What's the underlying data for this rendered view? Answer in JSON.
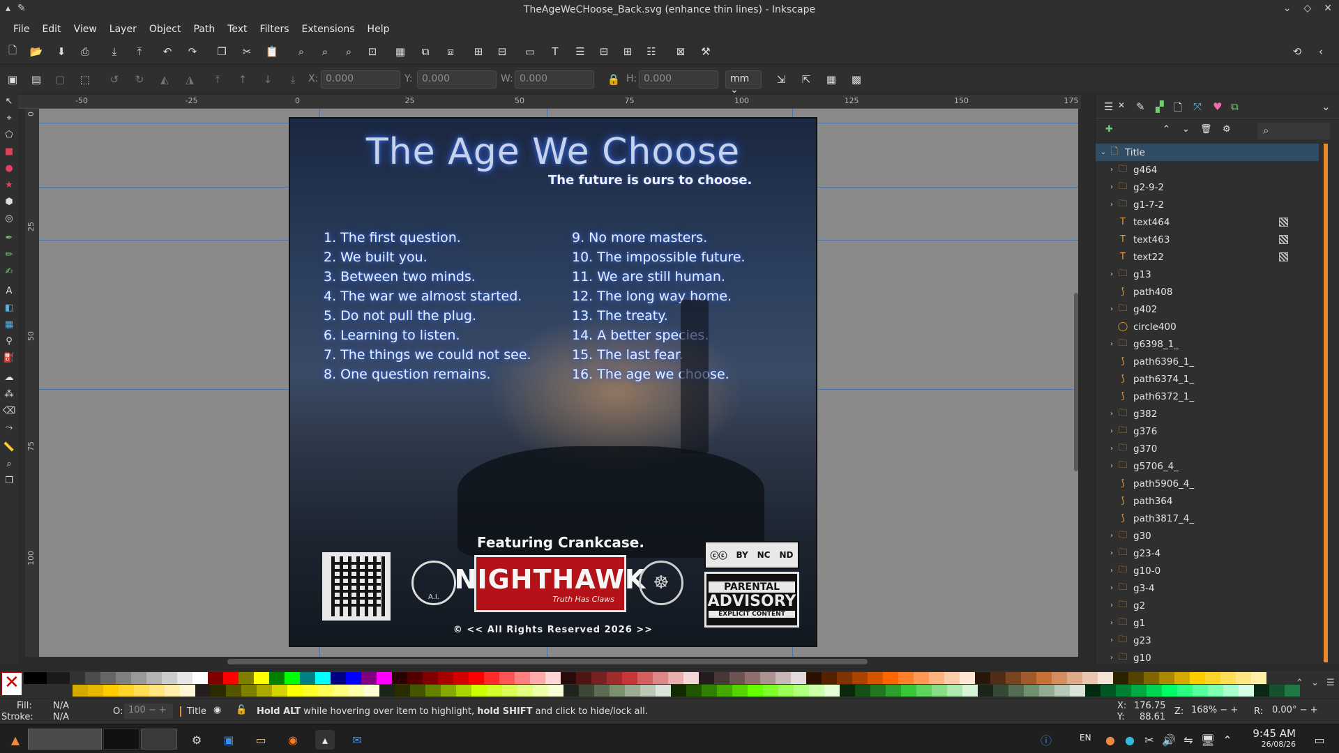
{
  "window": {
    "title": "TheAgeWeCHoose_Back.svg (enhance thin lines) - Inkscape"
  },
  "menu": [
    "File",
    "Edit",
    "View",
    "Layer",
    "Object",
    "Path",
    "Text",
    "Filters",
    "Extensions",
    "Help"
  ],
  "toolbar_icons": [
    "new-doc-icon",
    "open-icon",
    "save-icon",
    "print-icon",
    "import-icon",
    "export-icon",
    "undo-icon",
    "redo-icon",
    "copy-icon",
    "cut-icon",
    "paste-icon",
    "zoom-selection-icon",
    "zoom-drawing-icon",
    "zoom-page-icon",
    "zoom-width-icon",
    "duplicate-icon",
    "clone-icon",
    "unlink-clone-icon",
    "group-icon",
    "ungroup-icon",
    "xml-editor-icon",
    "text-icon",
    "layers-icon",
    "document-properties-icon",
    "align-icon",
    "preferences-icon",
    "fill-stroke-icon",
    "transform-icon"
  ],
  "transform": {
    "x_label": "X:",
    "x_value": "0.000",
    "y_label": "Y:",
    "y_value": "0.000",
    "w_label": "W:",
    "w_value": "0.000",
    "h_label": "H:",
    "h_value": "0.000",
    "unit": "mm"
  },
  "ruler": {
    "h_ticks": [
      "-50",
      "-25",
      "0",
      "25",
      "50",
      "75",
      "100",
      "125",
      "150",
      "175"
    ],
    "v_ticks": [
      "0",
      "25",
      "50",
      "75",
      "100"
    ]
  },
  "poster": {
    "title": "The Age We Choose",
    "subtitle": "The future is ours to choose.",
    "tracks_left": [
      "1. The first question.",
      "2. We built you.",
      "3. Between two minds.",
      "4. The war we almost started.",
      "5. Do not pull the plug.",
      "6.  Learning to listen.",
      "7. The things we could not see.",
      "8. One question remains."
    ],
    "tracks_right": [
      "9. No more masters.",
      "10. The impossible future.",
      "11. We are still human.",
      "12. The long way home.",
      "13. The treaty.",
      "14.  A better species.",
      "15. The last fear.",
      "16. The age we choose."
    ],
    "featuring": "Featuring Crankcase.",
    "ai_label": "A.I.",
    "label_name": "NIGHTHAWK",
    "label_tag": "Truth Has Claws",
    "cc_labels": [
      "BY",
      "NC",
      "ND"
    ],
    "advisory_top": "PARENTAL",
    "advisory_mid": "ADVISORY",
    "advisory_bottom": "EXPLICIT CONTENT",
    "rights": "© << All Rights Reserved 2026 >>"
  },
  "layers": [
    {
      "name": "Title",
      "type": "layer",
      "expand": "down",
      "selected": true
    },
    {
      "name": "g464",
      "type": "group",
      "expand": "right"
    },
    {
      "name": "g2-9-2",
      "type": "group",
      "expand": "right"
    },
    {
      "name": "g1-7-2",
      "type": "group",
      "expand": "right"
    },
    {
      "name": "text464",
      "type": "text",
      "expand": "",
      "mask": true
    },
    {
      "name": "text463",
      "type": "text",
      "expand": "",
      "mask": true
    },
    {
      "name": "text22",
      "type": "text",
      "expand": "",
      "mask": true
    },
    {
      "name": "g13",
      "type": "group",
      "expand": "right"
    },
    {
      "name": "path408",
      "type": "path",
      "expand": ""
    },
    {
      "name": "g402",
      "type": "group",
      "expand": "right"
    },
    {
      "name": "circle400",
      "type": "circle",
      "expand": ""
    },
    {
      "name": "g6398_1_",
      "type": "group",
      "expand": "right"
    },
    {
      "name": "path6396_1_",
      "type": "path",
      "expand": ""
    },
    {
      "name": "path6374_1_",
      "type": "path",
      "expand": ""
    },
    {
      "name": "path6372_1_",
      "type": "path",
      "expand": ""
    },
    {
      "name": "g382",
      "type": "group",
      "expand": "right"
    },
    {
      "name": "g376",
      "type": "group",
      "expand": "right"
    },
    {
      "name": "g370",
      "type": "group",
      "expand": "right"
    },
    {
      "name": "g5706_4_",
      "type": "group",
      "expand": "right"
    },
    {
      "name": "path5906_4_",
      "type": "path",
      "expand": ""
    },
    {
      "name": "path364",
      "type": "path",
      "expand": ""
    },
    {
      "name": "path3817_4_",
      "type": "path",
      "expand": ""
    },
    {
      "name": "g30",
      "type": "group",
      "expand": "right"
    },
    {
      "name": "g23-4",
      "type": "group",
      "expand": "right"
    },
    {
      "name": "g10-0",
      "type": "group",
      "expand": "right"
    },
    {
      "name": "g3-4",
      "type": "group",
      "expand": "right"
    },
    {
      "name": "g2",
      "type": "group",
      "expand": "right"
    },
    {
      "name": "g1",
      "type": "group",
      "expand": "right"
    },
    {
      "name": "g23",
      "type": "group",
      "expand": "right"
    },
    {
      "name": "g10",
      "type": "group",
      "expand": "right"
    }
  ],
  "status": {
    "fill_label": "Fill:",
    "fill_value": "N/A",
    "stroke_label": "Stroke:",
    "stroke_value": "N/A",
    "opacity_label": "O:",
    "opacity_value": "100",
    "layer": "Title",
    "hint_b1": "Hold ALT",
    "hint_t1": " while hovering over item to highlight, ",
    "hint_b2": "hold SHIFT",
    "hint_t2": " and click to hide/lock all.",
    "x_label": "X:",
    "x_value": "176.75",
    "y_label": "Y:",
    "y_value": "88.61",
    "zoom_label": "Z:",
    "zoom_value": "168%",
    "rot_label": "R:",
    "rot_value": "0.00°"
  },
  "taskbar": {
    "lang": "EN",
    "time": "9:45 AM",
    "date": "26/08/26"
  },
  "colors": {
    "accent": "#2f4c63",
    "glow": "#3b68d6",
    "orange": "#e78a2b"
  }
}
